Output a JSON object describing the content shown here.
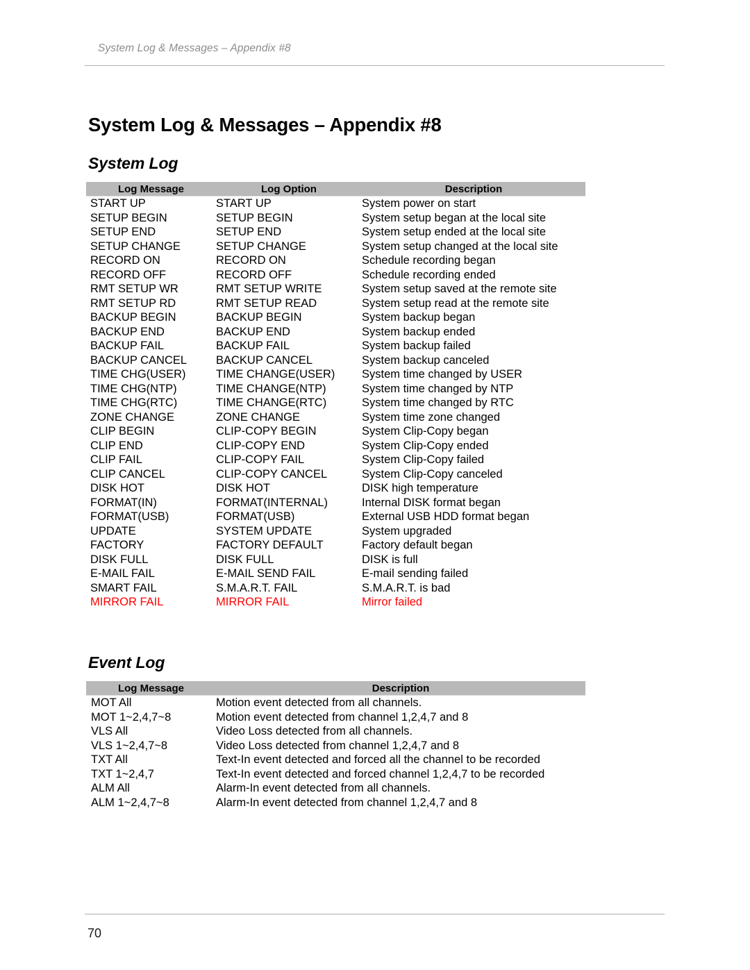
{
  "header": {
    "running_head": "System Log & Messages – Appendix #8"
  },
  "title": "System Log & Messages – Appendix #8",
  "sections": {
    "system_log": {
      "heading": "System Log",
      "columns": [
        "Log Message",
        "Log Option",
        "Description"
      ],
      "rows": [
        {
          "message": "START UP",
          "option": "START UP",
          "description": "System power on start"
        },
        {
          "message": "SETUP BEGIN",
          "option": "SETUP BEGIN",
          "description": "System setup began at the local site"
        },
        {
          "message": "SETUP END",
          "option": "SETUP END",
          "description": "System setup ended at the local site"
        },
        {
          "message": "SETUP CHANGE",
          "option": "SETUP CHANGE",
          "description": "System setup changed at the local site"
        },
        {
          "message": "RECORD ON",
          "option": "RECORD ON",
          "description": "Schedule recording began"
        },
        {
          "message": "RECORD OFF",
          "option": "RECORD OFF",
          "description": "Schedule recording ended"
        },
        {
          "message": "RMT SETUP WR",
          "option": "RMT SETUP WRITE",
          "description": "System setup saved at the remote site"
        },
        {
          "message": "RMT SETUP RD",
          "option": "RMT SETUP READ",
          "description": "System setup read at the remote site"
        },
        {
          "message": "BACKUP BEGIN",
          "option": "BACKUP BEGIN",
          "description": "System backup began"
        },
        {
          "message": "BACKUP END",
          "option": "BACKUP END",
          "description": "System backup ended"
        },
        {
          "message": "BACKUP FAIL",
          "option": "BACKUP FAIL",
          "description": "System backup failed"
        },
        {
          "message": "BACKUP CANCEL",
          "option": "BACKUP CANCEL",
          "description": "System backup canceled"
        },
        {
          "message": "TIME CHG(USER)",
          "option": "TIME CHANGE(USER)",
          "description": "System time changed by USER"
        },
        {
          "message": "TIME CHG(NTP)",
          "option": "TIME CHANGE(NTP)",
          "description": "System time changed by NTP"
        },
        {
          "message": "TIME CHG(RTC)",
          "option": "TIME CHANGE(RTC)",
          "description": "System time changed by RTC"
        },
        {
          "message": "ZONE CHANGE",
          "option": "ZONE CHANGE",
          "description": "System time zone changed"
        },
        {
          "message": "CLIP BEGIN",
          "option": "CLIP-COPY BEGIN",
          "description": "System Clip-Copy began"
        },
        {
          "message": "CLIP END",
          "option": "CLIP-COPY END",
          "description": "System Clip-Copy ended"
        },
        {
          "message": "CLIP FAIL",
          "option": "CLIP-COPY FAIL",
          "description": "System Clip-Copy failed"
        },
        {
          "message": "CLIP CANCEL",
          "option": "CLIP-COPY CANCEL",
          "description": "System Clip-Copy canceled"
        },
        {
          "message": "DISK HOT",
          "option": "DISK HOT",
          "description": "DISK high temperature"
        },
        {
          "message": "FORMAT(IN)",
          "option": "FORMAT(INTERNAL)",
          "description": "Internal DISK format began"
        },
        {
          "message": "FORMAT(USB)",
          "option": "FORMAT(USB)",
          "description": "External USB HDD format began"
        },
        {
          "message": "UPDATE",
          "option": "SYSTEM UPDATE",
          "description": "System upgraded"
        },
        {
          "message": "FACTORY",
          "option": "FACTORY DEFAULT",
          "description": "Factory default began"
        },
        {
          "message": "DISK FULL",
          "option": "DISK FULL",
          "description": "DISK is full"
        },
        {
          "message": "E-MAIL FAIL",
          "option": "E-MAIL SEND FAIL",
          "description": "E-mail sending failed"
        },
        {
          "message": "SMART FAIL",
          "option": "S.M.A.R.T. FAIL",
          "description": "S.M.A.R.T. is bad"
        },
        {
          "message": "MIRROR FAIL",
          "option": "MIRROR FAIL",
          "description": "Mirror failed",
          "highlight": "alert"
        }
      ]
    },
    "event_log": {
      "heading": "Event Log",
      "columns": [
        "Log Message",
        "Description"
      ],
      "rows": [
        {
          "message": "MOT All",
          "description": "Motion event detected from all channels."
        },
        {
          "message": "MOT 1~2,4,7~8",
          "description": "Motion event detected from channel 1,2,4,7 and 8"
        },
        {
          "message": "VLS All",
          "description": "Video Loss detected from all channels."
        },
        {
          "message": "VLS 1~2,4,7~8",
          "description": "Video Loss detected from channel 1,2,4,7 and 8"
        },
        {
          "message": "TXT All",
          "description": "Text-In event detected and forced all the channel to be recorded"
        },
        {
          "message": "TXT 1~2,4,7",
          "description": "Text-In event detected and forced channel 1,2,4,7 to be recorded"
        },
        {
          "message": "ALM All",
          "description": "Alarm-In event detected from all channels."
        },
        {
          "message": "ALM 1~2,4,7~8",
          "description": "Alarm-In event detected from channel 1,2,4,7 and 8"
        }
      ]
    }
  },
  "footer": {
    "page_number": "70"
  },
  "colors": {
    "header_bar": "#b9b9b9",
    "alert_text": "#ff0000",
    "rule": "#b0b0b0",
    "running_head_text": "#8d8d8d"
  }
}
